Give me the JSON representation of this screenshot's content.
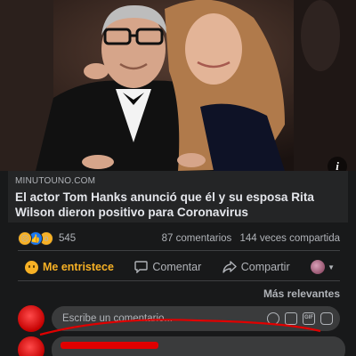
{
  "post": {
    "link": {
      "source": "MINUTOUNO.COM",
      "headline": "El actor Tom Hanks anunció que él y su esposa Rita Wilson dieron positivo para Coronavirus",
      "info_icon": "info-icon"
    },
    "stats": {
      "reaction_icons": [
        "sad-reaction-icon",
        "like-reaction-icon",
        "wow-reaction-icon"
      ],
      "reaction_count": "545",
      "comments": "87 comentarios",
      "shares": "144 veces compartida"
    },
    "actions": {
      "react_label": "Me entristece",
      "comment_label": "Comentar",
      "share_label": "Compartir"
    },
    "comments": {
      "sort_label": "Más relevantes",
      "input_placeholder": "Escribe un comentario...",
      "input_icons": [
        "emoji-icon",
        "camera-icon",
        "gif-icon",
        "sticker-icon"
      ],
      "gif_text": "GIF"
    },
    "colors": {
      "background": "#18191a",
      "card": "#242526",
      "text": "#e4e6eb",
      "muted": "#b0b3b8",
      "sad_accent": "#f7b125",
      "like_blue": "#1877f2",
      "redaction": "#e00000"
    }
  }
}
